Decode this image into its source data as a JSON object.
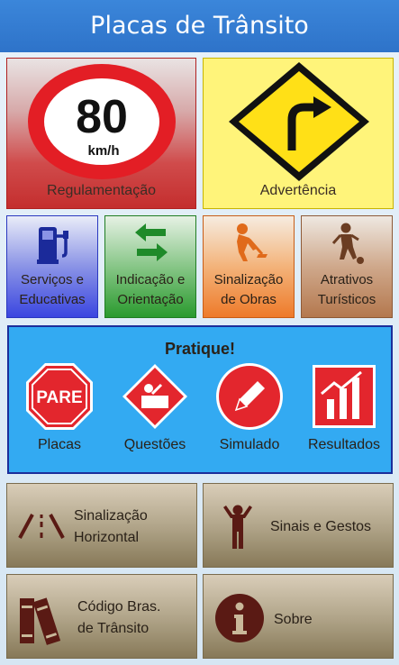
{
  "header": {
    "title": "Placas de Trânsito"
  },
  "main_tiles": {
    "regulamentacao": {
      "label": "Regulamentação",
      "sign_value": "80",
      "sign_unit": "km/h"
    },
    "advertencia": {
      "label": "Advertência"
    }
  },
  "category_tiles": [
    {
      "line1": "Serviços e",
      "line2": "Educativas"
    },
    {
      "line1": "Indicação e",
      "line2": "Orientação"
    },
    {
      "line1": "Sinalização",
      "line2": "de Obras"
    },
    {
      "line1": "Atrativos",
      "line2": "Turísticos"
    }
  ],
  "practice": {
    "title": "Pratique!",
    "items": [
      {
        "label": "Placas",
        "sign_text": "PARE"
      },
      {
        "label": "Questões"
      },
      {
        "label": "Simulado"
      },
      {
        "label": "Resultados"
      }
    ]
  },
  "bottom_tiles": [
    {
      "line1": "Sinalização",
      "line2": "Horizontal"
    },
    {
      "line1": "Sinais e Gestos",
      "line2": ""
    },
    {
      "line1": "Código Bras.",
      "line2": "de Trânsito"
    },
    {
      "line1": "Sobre",
      "line2": ""
    }
  ],
  "colors": {
    "header": "#2e73c9",
    "practice_bg": "#33aaf2",
    "practice_border": "#1c2e9a",
    "stop_red": "#e3262d",
    "bottom_icon": "#5a1a14"
  }
}
